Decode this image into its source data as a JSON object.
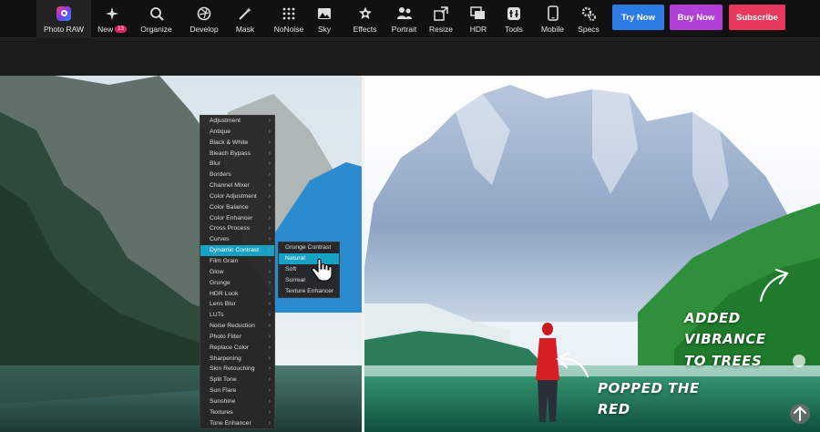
{
  "nav": {
    "items": [
      {
        "label": "Photo RAW",
        "icon": "photo-raw-logo-icon"
      },
      {
        "label": "New",
        "icon": "sparkle-icon",
        "badge": "13"
      },
      {
        "label": "Organize",
        "icon": "organize-icon"
      },
      {
        "label": "Develop",
        "icon": "aperture-icon"
      },
      {
        "label": "Mask",
        "icon": "magic-wand-icon"
      },
      {
        "label": "NoNoise",
        "icon": "dot-grid-icon"
      },
      {
        "label": "Sky",
        "icon": "landscape-icon"
      },
      {
        "label": "Effects",
        "icon": "effects-icon"
      },
      {
        "label": "Portrait",
        "icon": "people-icon"
      },
      {
        "label": "Resize",
        "icon": "resize-icon"
      },
      {
        "label": "HDR",
        "icon": "hdr-icon"
      },
      {
        "label": "Tools",
        "icon": "toolbox-icon"
      },
      {
        "label": "Mobile",
        "icon": "mobile-icon"
      },
      {
        "label": "Specs",
        "icon": "gears-icon"
      }
    ]
  },
  "cta": {
    "try": "Try Now",
    "buy": "Buy Now",
    "subscribe": "Subscribe"
  },
  "colors": {
    "try": "#2c7be5",
    "buy": "#b23fd8",
    "subscribe": "#e8385d",
    "highlight": "#17a2c4"
  },
  "menu": {
    "items": [
      "Adjustment",
      "Antique",
      "Black & White",
      "Bleach Bypass",
      "Blur",
      "Borders",
      "Channel Mixer",
      "Color Adjustment",
      "Color Balance",
      "Color Enhancer",
      "Cross Process",
      "Curves",
      "Dynamic Contrast",
      "Film Grain",
      "Glow",
      "Grunge",
      "HDR Look",
      "Lens Blur",
      "LUTs",
      "Noise Reduction",
      "Photo Filter",
      "Replace Color",
      "Sharpening",
      "Skin Retouching",
      "Split Tone",
      "Sun Flare",
      "Sunshine",
      "Textures",
      "Tone Enhancer"
    ],
    "selected": "Dynamic Contrast"
  },
  "submenu": {
    "items": [
      "Grunge Contrast",
      "Natural",
      "Soft",
      "Surreal",
      "Texture Enhancer"
    ],
    "selected": "Natural"
  },
  "annotations": {
    "vibrance_line1": "ADDED VIBRANCE",
    "vibrance_line2": "TO TREES",
    "red_line1": "POPPED THE",
    "red_line2": "RED"
  }
}
